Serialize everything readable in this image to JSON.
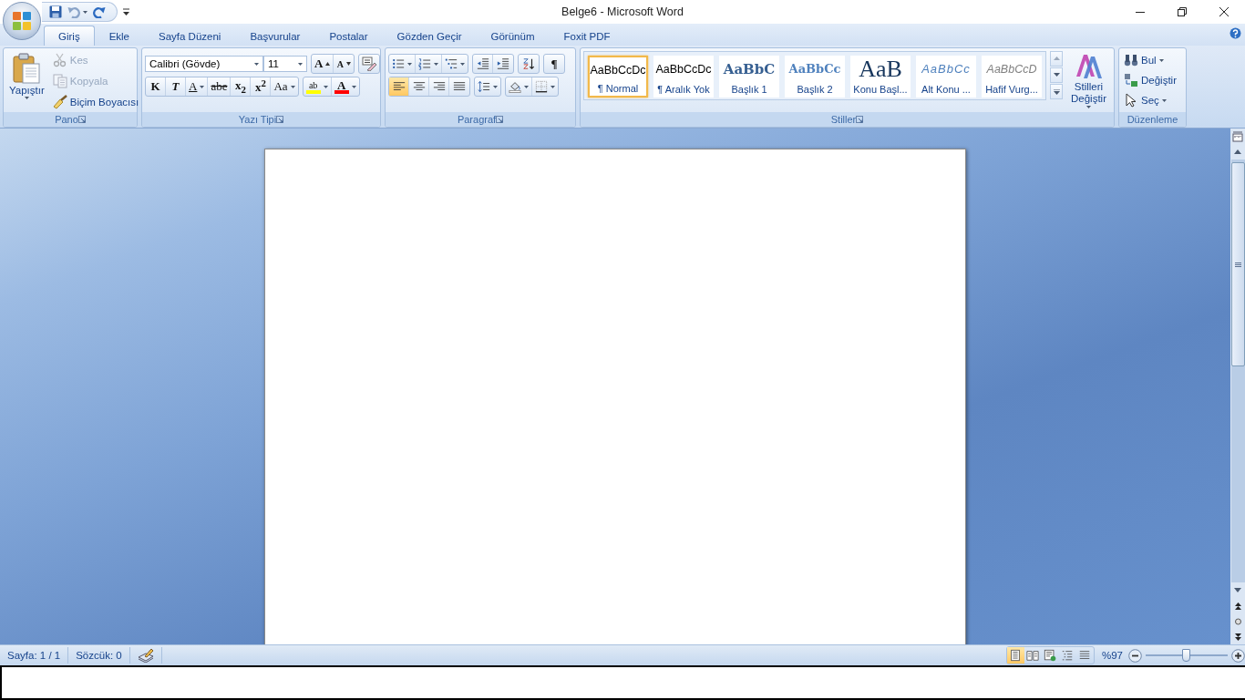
{
  "window": {
    "title": "Belge6 - Microsoft Word"
  },
  "tabs": [
    {
      "label": "Giriş",
      "selected": true
    },
    {
      "label": "Ekle",
      "selected": false
    },
    {
      "label": "Sayfa Düzeni",
      "selected": false
    },
    {
      "label": "Başvurular",
      "selected": false
    },
    {
      "label": "Postalar",
      "selected": false
    },
    {
      "label": "Gözden Geçir",
      "selected": false
    },
    {
      "label": "Görünüm",
      "selected": false
    },
    {
      "label": "Foxit PDF",
      "selected": false
    }
  ],
  "ribbon": {
    "groups": [
      {
        "kind": "clipboard",
        "label": "Pano",
        "paste": "Yapıştır",
        "items": [
          {
            "kind": "cut",
            "label": "Kes",
            "disabled": true
          },
          {
            "kind": "copy",
            "label": "Kopyala",
            "disabled": true
          },
          {
            "kind": "format_painter",
            "label": "Biçim Boyacısı",
            "disabled": false
          }
        ]
      },
      {
        "kind": "font",
        "label": "Yazı Tipi",
        "font_name": "Calibri (Gövde)",
        "font_size": "11",
        "size_buttons": [
          {
            "kind": "grow",
            "label": "A"
          },
          {
            "kind": "shrink",
            "label": "A"
          }
        ],
        "format_buttons": [
          {
            "kind": "bold",
            "label": "K"
          },
          {
            "kind": "italic",
            "label": "T"
          },
          {
            "kind": "underline",
            "label": "A"
          },
          {
            "kind": "strikethrough",
            "label": "abe"
          },
          {
            "kind": "subscript",
            "label": "x$_{2}$"
          },
          {
            "kind": "superscript",
            "label": "x$^{2}$"
          },
          {
            "kind": "case",
            "label": "Aa"
          }
        ],
        "color_buttons": [
          {
            "kind": "highlight",
            "label": "ab",
            "color": "#ffff00"
          },
          {
            "kind": "font_color",
            "label": "A",
            "color": "#ff0000"
          }
        ]
      },
      {
        "kind": "paragraph",
        "label": "Paragraf",
        "show_marks": "¶",
        "alignments": [
          {
            "kind": "left",
            "selected": true
          },
          {
            "kind": "center",
            "selected": false
          },
          {
            "kind": "right",
            "selected": false
          },
          {
            "kind": "justify",
            "selected": false
          }
        ]
      },
      {
        "kind": "styles",
        "label": "Stiller",
        "change_styles": "Stilleri Değiştir",
        "styles": [
          {
            "kind": "normal",
            "preview": "AaBbCcDc",
            "label": "¶ Normal",
            "selected": true
          },
          {
            "kind": "no_spacing",
            "preview": "AaBbCcDc",
            "label": "¶ Aralık Yok",
            "selected": false
          },
          {
            "kind": "heading1",
            "preview": "AaBbC",
            "label": "Başlık 1",
            "selected": false
          },
          {
            "kind": "heading2",
            "preview": "AaBbCc",
            "label": "Başlık 2",
            "selected": false
          },
          {
            "kind": "title",
            "preview": "AaB",
            "label": "Konu Başl...",
            "selected": false
          },
          {
            "kind": "subtitle",
            "preview": "AaBbCc",
            "label": "Alt Konu ...",
            "selected": false
          },
          {
            "kind": "emphasis",
            "preview": "AaBbCcD",
            "label": "Hafif Vurg...",
            "selected": false
          }
        ]
      },
      {
        "kind": "editing",
        "label": "Düzenleme",
        "items": [
          {
            "kind": "find",
            "label": "Bul"
          },
          {
            "kind": "replace",
            "label": "Değiştir"
          },
          {
            "kind": "select",
            "label": "Seç"
          }
        ]
      }
    ]
  },
  "status_bar": {
    "page": "Sayfa: 1 / 1",
    "words": "Sözcük: 0",
    "views": [
      {
        "kind": "print_layout",
        "selected": true
      },
      {
        "kind": "full_screen_reading",
        "selected": false
      },
      {
        "kind": "web_layout",
        "selected": false
      },
      {
        "kind": "outline",
        "selected": false
      },
      {
        "kind": "draft",
        "selected": false
      }
    ],
    "zoom": "%97",
    "zoom_slider": {
      "level": 0.49
    }
  }
}
